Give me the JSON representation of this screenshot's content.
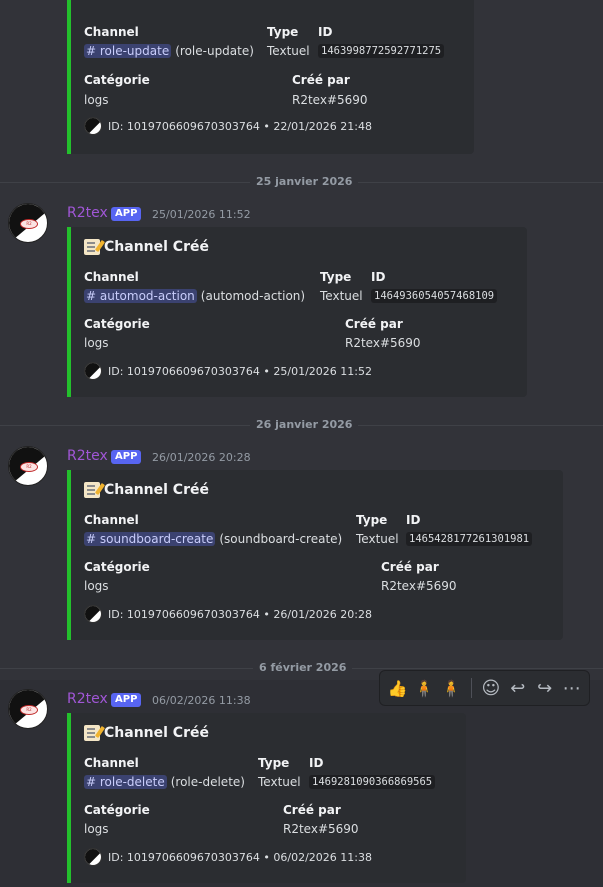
{
  "labels": {
    "channel": "Channel",
    "type": "Type",
    "id": "ID",
    "category": "Catégorie",
    "created_by": "Créé par"
  },
  "embed0": {
    "mention": "# role-update",
    "paren": "(role-update)",
    "type_value": "Textuel",
    "id_value": "1463998772592771275",
    "category_value": "logs",
    "creator_value": "R2tex#5690",
    "footer": "ID: 1019706609670303764 • 22/01/2026 21:48"
  },
  "dividers": [
    "25 janvier 2026",
    "26 janvier 2026",
    "6 février 2026"
  ],
  "messages": [
    {
      "author": "R2tex",
      "app_tag": "APP",
      "timestamp": "25/01/2026 11:52",
      "embed_title": "Channel Créé",
      "mention": "# automod-action",
      "paren": "(automod-action)",
      "type_value": "Textuel",
      "id_value": "1464936054057468109",
      "category_value": "logs",
      "creator_value": "R2tex#5690",
      "footer": "ID: 1019706609670303764 • 25/01/2026 11:52"
    },
    {
      "author": "R2tex",
      "app_tag": "APP",
      "timestamp": "26/01/2026 20:28",
      "embed_title": "Channel Créé",
      "mention": "# soundboard-create",
      "paren": "(soundboard-create)",
      "type_value": "Textuel",
      "id_value": "1465428177261301981",
      "category_value": "logs",
      "creator_value": "R2tex#5690",
      "footer": "ID: 1019706609670303764 • 26/01/2026 20:28"
    },
    {
      "author": "R2tex",
      "app_tag": "APP",
      "timestamp": "06/02/2026 11:38",
      "embed_title": "Channel Créé",
      "mention": "# role-delete",
      "paren": "(role-delete)",
      "type_value": "Textuel",
      "id_value": "1469281090366869565",
      "category_value": "logs",
      "creator_value": "R2tex#5690",
      "footer": "ID: 1019706609670303764 • 06/02/2026 11:38"
    }
  ],
  "reactions": {
    "icons": [
      "thumbs-up-icon",
      "person-green-icon",
      "person-orange-icon",
      "add-reaction-icon",
      "reply-icon",
      "forward-icon",
      "more-icon"
    ],
    "glyphs": [
      "👍",
      "🧍",
      "🧍",
      "☺",
      "↩",
      "↪",
      "⋯"
    ]
  },
  "colors": {
    "accent_green": "#23c02c",
    "author_purple": "#a056d6",
    "app_blue": "#5865f2",
    "background": "#323339",
    "embed_bg": "#2b2d31"
  }
}
